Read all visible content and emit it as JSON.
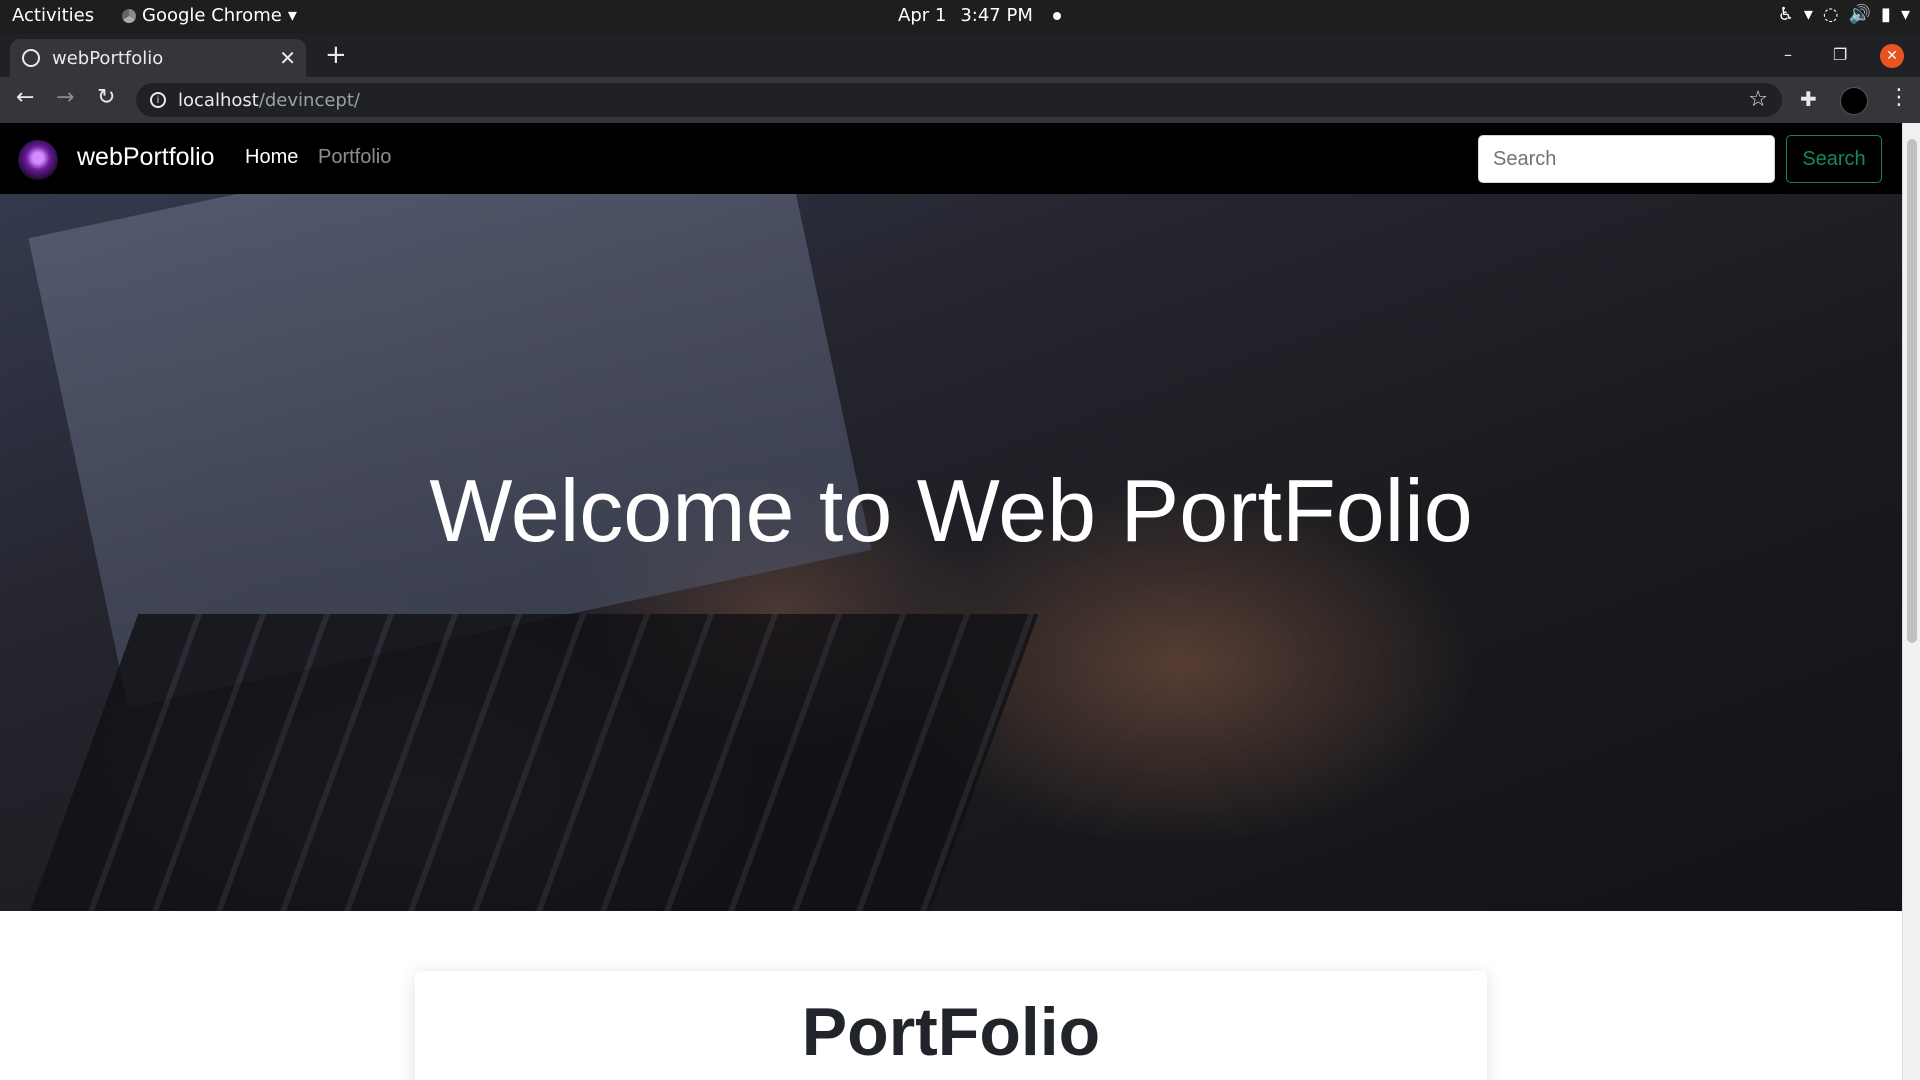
{
  "system_bar": {
    "activities": "Activities",
    "app_name": "Google Chrome",
    "date": "Apr 1",
    "time": "3:47 PM"
  },
  "browser": {
    "tab_title": "webPortfolio",
    "url_host": "localhost",
    "url_path": "/devincept/"
  },
  "site": {
    "brand": "webPortfolio",
    "nav": {
      "home": "Home",
      "portfolio": "Portfolio"
    },
    "search": {
      "placeholder": "Search",
      "button": "Search"
    },
    "hero_title": "Welcome to Web PortFolio",
    "section_title": "PortFolio"
  },
  "colors": {
    "navbar_bg": "#000000",
    "search_button": "#198754",
    "window_close": "#e95420"
  },
  "icons": [
    "chrome-icon",
    "accessibility-icon",
    "network-icon",
    "volume-icon",
    "battery-icon",
    "globe-icon",
    "info-icon",
    "star-icon",
    "puzzle-icon",
    "profile-icon",
    "kebab-menu-icon"
  ]
}
